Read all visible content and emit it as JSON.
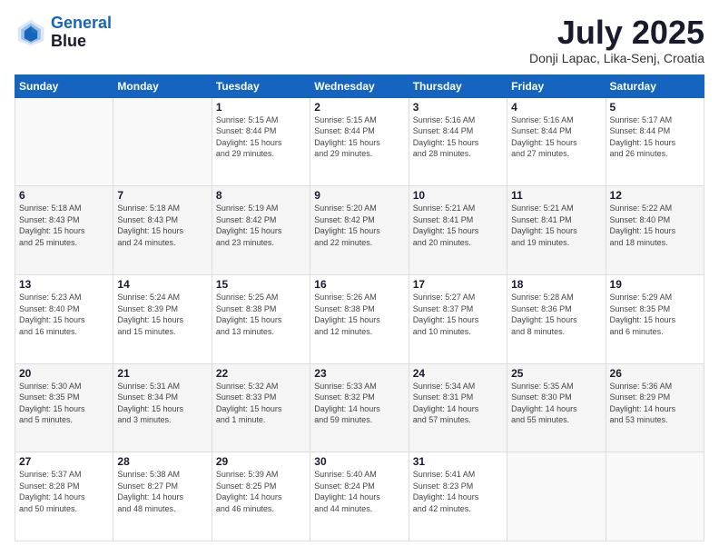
{
  "logo": {
    "line1": "General",
    "line2": "Blue"
  },
  "title": "July 2025",
  "subtitle": "Donji Lapac, Lika-Senj, Croatia",
  "weekdays": [
    "Sunday",
    "Monday",
    "Tuesday",
    "Wednesday",
    "Thursday",
    "Friday",
    "Saturday"
  ],
  "weeks": [
    [
      {
        "day": "",
        "info": ""
      },
      {
        "day": "",
        "info": ""
      },
      {
        "day": "1",
        "info": "Sunrise: 5:15 AM\nSunset: 8:44 PM\nDaylight: 15 hours\nand 29 minutes."
      },
      {
        "day": "2",
        "info": "Sunrise: 5:15 AM\nSunset: 8:44 PM\nDaylight: 15 hours\nand 29 minutes."
      },
      {
        "day": "3",
        "info": "Sunrise: 5:16 AM\nSunset: 8:44 PM\nDaylight: 15 hours\nand 28 minutes."
      },
      {
        "day": "4",
        "info": "Sunrise: 5:16 AM\nSunset: 8:44 PM\nDaylight: 15 hours\nand 27 minutes."
      },
      {
        "day": "5",
        "info": "Sunrise: 5:17 AM\nSunset: 8:44 PM\nDaylight: 15 hours\nand 26 minutes."
      }
    ],
    [
      {
        "day": "6",
        "info": "Sunrise: 5:18 AM\nSunset: 8:43 PM\nDaylight: 15 hours\nand 25 minutes."
      },
      {
        "day": "7",
        "info": "Sunrise: 5:18 AM\nSunset: 8:43 PM\nDaylight: 15 hours\nand 24 minutes."
      },
      {
        "day": "8",
        "info": "Sunrise: 5:19 AM\nSunset: 8:42 PM\nDaylight: 15 hours\nand 23 minutes."
      },
      {
        "day": "9",
        "info": "Sunrise: 5:20 AM\nSunset: 8:42 PM\nDaylight: 15 hours\nand 22 minutes."
      },
      {
        "day": "10",
        "info": "Sunrise: 5:21 AM\nSunset: 8:41 PM\nDaylight: 15 hours\nand 20 minutes."
      },
      {
        "day": "11",
        "info": "Sunrise: 5:21 AM\nSunset: 8:41 PM\nDaylight: 15 hours\nand 19 minutes."
      },
      {
        "day": "12",
        "info": "Sunrise: 5:22 AM\nSunset: 8:40 PM\nDaylight: 15 hours\nand 18 minutes."
      }
    ],
    [
      {
        "day": "13",
        "info": "Sunrise: 5:23 AM\nSunset: 8:40 PM\nDaylight: 15 hours\nand 16 minutes."
      },
      {
        "day": "14",
        "info": "Sunrise: 5:24 AM\nSunset: 8:39 PM\nDaylight: 15 hours\nand 15 minutes."
      },
      {
        "day": "15",
        "info": "Sunrise: 5:25 AM\nSunset: 8:38 PM\nDaylight: 15 hours\nand 13 minutes."
      },
      {
        "day": "16",
        "info": "Sunrise: 5:26 AM\nSunset: 8:38 PM\nDaylight: 15 hours\nand 12 minutes."
      },
      {
        "day": "17",
        "info": "Sunrise: 5:27 AM\nSunset: 8:37 PM\nDaylight: 15 hours\nand 10 minutes."
      },
      {
        "day": "18",
        "info": "Sunrise: 5:28 AM\nSunset: 8:36 PM\nDaylight: 15 hours\nand 8 minutes."
      },
      {
        "day": "19",
        "info": "Sunrise: 5:29 AM\nSunset: 8:35 PM\nDaylight: 15 hours\nand 6 minutes."
      }
    ],
    [
      {
        "day": "20",
        "info": "Sunrise: 5:30 AM\nSunset: 8:35 PM\nDaylight: 15 hours\nand 5 minutes."
      },
      {
        "day": "21",
        "info": "Sunrise: 5:31 AM\nSunset: 8:34 PM\nDaylight: 15 hours\nand 3 minutes."
      },
      {
        "day": "22",
        "info": "Sunrise: 5:32 AM\nSunset: 8:33 PM\nDaylight: 15 hours\nand 1 minute."
      },
      {
        "day": "23",
        "info": "Sunrise: 5:33 AM\nSunset: 8:32 PM\nDaylight: 14 hours\nand 59 minutes."
      },
      {
        "day": "24",
        "info": "Sunrise: 5:34 AM\nSunset: 8:31 PM\nDaylight: 14 hours\nand 57 minutes."
      },
      {
        "day": "25",
        "info": "Sunrise: 5:35 AM\nSunset: 8:30 PM\nDaylight: 14 hours\nand 55 minutes."
      },
      {
        "day": "26",
        "info": "Sunrise: 5:36 AM\nSunset: 8:29 PM\nDaylight: 14 hours\nand 53 minutes."
      }
    ],
    [
      {
        "day": "27",
        "info": "Sunrise: 5:37 AM\nSunset: 8:28 PM\nDaylight: 14 hours\nand 50 minutes."
      },
      {
        "day": "28",
        "info": "Sunrise: 5:38 AM\nSunset: 8:27 PM\nDaylight: 14 hours\nand 48 minutes."
      },
      {
        "day": "29",
        "info": "Sunrise: 5:39 AM\nSunset: 8:25 PM\nDaylight: 14 hours\nand 46 minutes."
      },
      {
        "day": "30",
        "info": "Sunrise: 5:40 AM\nSunset: 8:24 PM\nDaylight: 14 hours\nand 44 minutes."
      },
      {
        "day": "31",
        "info": "Sunrise: 5:41 AM\nSunset: 8:23 PM\nDaylight: 14 hours\nand 42 minutes."
      },
      {
        "day": "",
        "info": ""
      },
      {
        "day": "",
        "info": ""
      }
    ]
  ]
}
